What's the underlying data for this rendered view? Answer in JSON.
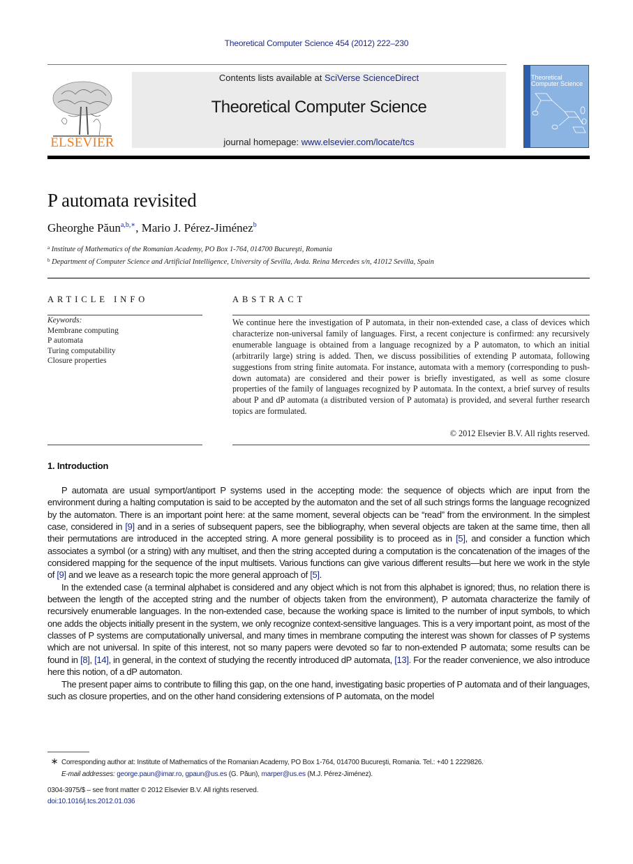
{
  "running_head": "Theoretical Computer Science 454 (2012) 222–230",
  "masthead": {
    "publisher_logo_text": "ELSEVIER",
    "contents_prefix": "Contents lists available at ",
    "contents_link": "SciVerse ScienceDirect",
    "journal_name": "Theoretical Computer Science",
    "homepage_prefix": "journal homepage: ",
    "homepage_link": "www.elsevier.com/locate/tcs",
    "cover_title_line1": "Theoretical",
    "cover_title_line2": "Computer Science",
    "colors": {
      "link": "#1c2a8a",
      "publisher_orange": "#f07d1d",
      "cover_blue": "#8cb4e2",
      "band_gray": "#ebebeb"
    }
  },
  "article": {
    "title": "P automata revisited",
    "authors": [
      {
        "name": "Gheorghe Păun",
        "marks": "a,b,∗"
      },
      {
        "name": "Mario J. Pérez-Jiménez",
        "marks": "b"
      }
    ],
    "author_separator": ", ",
    "affiliations": [
      {
        "mark": "a",
        "text": "Institute of Mathematics of the Romanian Academy, PO Box 1-764, 014700 Bucureşti, Romania"
      },
      {
        "mark": "b",
        "text": "Department of Computer Science and Artificial Intelligence, University of Sevilla, Avda. Reina Mercedes s/n, 41012 Sevilla, Spain"
      }
    ]
  },
  "article_info": {
    "heading": "ARTICLE INFO",
    "keywords_label": "Keywords:",
    "keywords": [
      "Membrane computing",
      "P automata",
      "Turing computability",
      "Closure properties"
    ]
  },
  "abstract": {
    "heading": "ABSTRACT",
    "text": "We continue here the investigation of P automata, in their non-extended case, a class of devices which characterize non-universal family of languages. First, a recent conjecture is confirmed: any recursively enumerable language is obtained from a language recognized by a P automaton, to which an initial (arbitrarily large) string is added. Then, we discuss possibilities of extending P automata, following suggestions from string finite automata. For instance, automata with a memory (corresponding to push-down automata) are considered and their power is briefly investigated, as well as some closure properties of the family of languages recognized by P automata. In the context, a brief survey of results about P and dP automata (a distributed version of P automata) is provided, and several further research topics are formulated.",
    "copyright": "© 2012 Elsevier B.V. All rights reserved."
  },
  "introduction": {
    "heading": "1.  Introduction",
    "paragraphs": [
      [
        {
          "t": "P automata are usual symport/antiport P systems used in the accepting mode: the sequence of objects which are input from the environment during a halting computation is said to be accepted by the automaton and the set of all such strings forms the language recognized by the automaton. There is an important point here: at the same moment, several objects can be “read” from the environment. In the simplest case, considered in "
        },
        {
          "ref": "[9]"
        },
        {
          "t": " and in a series of subsequent papers, see the bibliography, when several objects are taken at the same time, then all their permutations are introduced in the accepted string. A more general possibility is to proceed as in "
        },
        {
          "ref": "[5]"
        },
        {
          "t": ", and consider a function which associates a symbol (or a string) with any multiset, and then the string accepted during a computation is the concatenation of the images of the considered mapping for the sequence of the input multisets. Various functions can give various different results—but here we work in the style of "
        },
        {
          "ref": "[9]"
        },
        {
          "t": " and we leave as a research topic the more general approach of "
        },
        {
          "ref": "[5]"
        },
        {
          "t": "."
        }
      ],
      [
        {
          "t": "In the extended case (a terminal alphabet is considered and any object which is not from this alphabet is ignored; thus, no relation there is between the length of the accepted string and the number of objects taken from the environment), P automata characterize the family of recursively enumerable languages. In the non-extended case, because the working space is limited to the number of input symbols, to which one adds the objects initially present in the system, we only recognize context-sensitive languages. This is a very important point, as most of the classes of P systems are computationally universal, and many times in membrane computing the interest was shown for classes of P systems which are not universal. In spite of this interest, not so many papers were devoted so far to non-extended P automata; some results can be found in "
        },
        {
          "ref": "[8]"
        },
        {
          "t": ", "
        },
        {
          "ref": "[14]"
        },
        {
          "t": ", in general, in the context of studying the recently introduced dP automata, "
        },
        {
          "ref": "[13]"
        },
        {
          "t": ". For the reader convenience, we also introduce here this notion, of a dP automaton."
        }
      ],
      [
        {
          "t": "The present paper aims to contribute to filling this gap, on the one hand, investigating basic properties of P automata and of their languages, such as closure properties, and on the other hand considering extensions of P automata, on the model"
        }
      ]
    ]
  },
  "footnotes": {
    "star": "∗",
    "corresponding": "Corresponding author at: Institute of Mathematics of the Romanian Academy, PO Box 1-764, 014700 Bucureşti, Romania. Tel.: +40 1 2229826.",
    "email_label": "E-mail addresses:",
    "emails": [
      {
        "addr": "george.paun@imar.ro",
        "after": ", "
      },
      {
        "addr": "gpaun@us.es",
        "after": " (G. Păun), "
      },
      {
        "addr": "marper@us.es",
        "after": " (M.J. Pérez-Jiménez)."
      }
    ],
    "issn_line": "0304-3975/$ – see front matter © 2012 Elsevier B.V. All rights reserved.",
    "doi": "doi:10.1016/j.tcs.2012.01.036"
  }
}
